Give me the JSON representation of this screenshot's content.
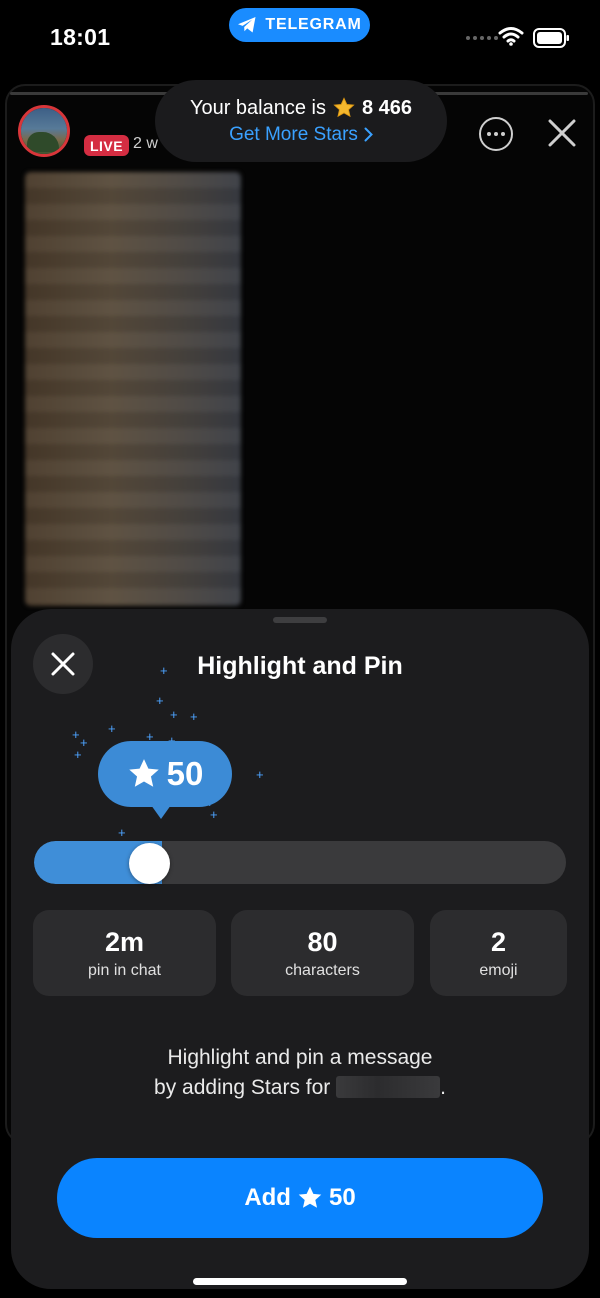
{
  "status_bar": {
    "time": "18:01",
    "app_pill": "TELEGRAM",
    "icons": [
      "telegram-plane-icon",
      "signal-dots-icon",
      "wifi-icon",
      "battery-icon"
    ]
  },
  "story": {
    "live_label": "LIVE",
    "watch_text": "2 w",
    "icons": [
      "more-icon",
      "close-icon"
    ]
  },
  "balance": {
    "prefix": "Your balance is",
    "amount": "8 466",
    "link": "Get More Stars",
    "icons": [
      "star-icon",
      "chevron-right-icon"
    ]
  },
  "sheet": {
    "title": "Highlight and Pin",
    "bubble_value": "50",
    "slider_fraction": 0.24,
    "stats": [
      {
        "value": "2m",
        "label": "pin in chat"
      },
      {
        "value": "80",
        "label": "characters"
      },
      {
        "value": "2",
        "label": "emoji"
      }
    ],
    "description_line1": "Highlight and pin a message",
    "description_line2": "by adding Stars for",
    "description_end": ".",
    "button_prefix": "Add",
    "button_amount": "50",
    "icons": [
      "close-icon",
      "star-icon",
      "sparkle-icon"
    ]
  },
  "colors": {
    "accent": "#0a84ff",
    "bubble": "#3c8bd6",
    "live": "#d52d42",
    "link": "#3aa1ff",
    "star_gold": "#f5b82e"
  }
}
